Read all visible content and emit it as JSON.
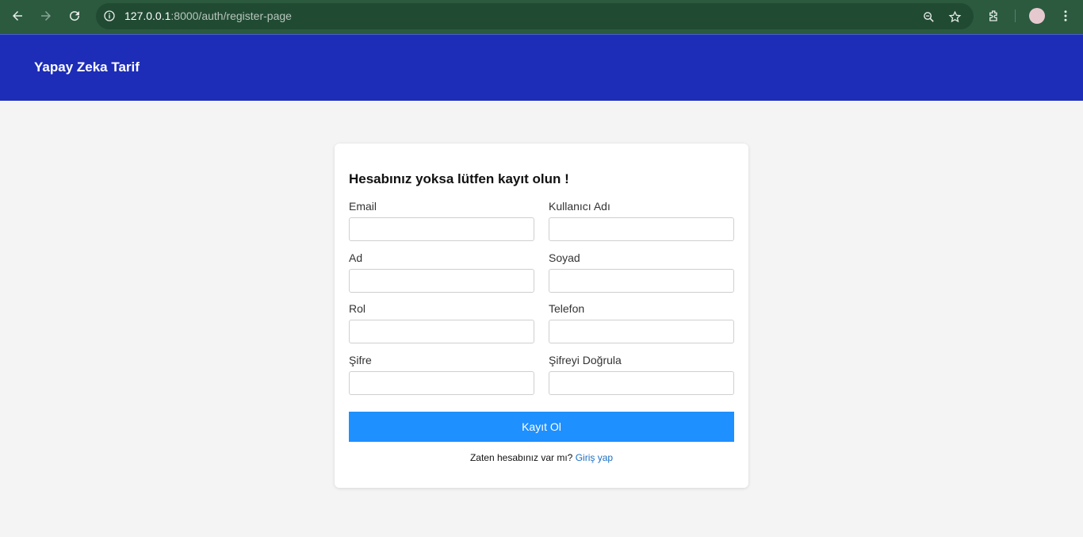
{
  "browser": {
    "url_host": "127.0.0.1",
    "url_rest": ":8000/auth/register-page",
    "icons": [
      "back-icon",
      "forward-icon",
      "reload-icon",
      "site-info-icon",
      "zoom-icon",
      "bookmark-star-icon",
      "extensions-icon",
      "profile-avatar",
      "menu-icon"
    ]
  },
  "header": {
    "brand": "Yapay Zeka Tarif"
  },
  "form": {
    "title": "Hesabınız yoksa lütfen kayıt olun !",
    "fields": {
      "email": {
        "label": "Email",
        "value": ""
      },
      "username": {
        "label": "Kullanıcı Adı",
        "value": ""
      },
      "first_name": {
        "label": "Ad",
        "value": ""
      },
      "last_name": {
        "label": "Soyad",
        "value": ""
      },
      "role": {
        "label": "Rol",
        "value": ""
      },
      "phone": {
        "label": "Telefon",
        "value": ""
      },
      "password": {
        "label": "Şifre",
        "value": ""
      },
      "password_confirm": {
        "label": "Şifreyi Doğrula",
        "value": ""
      }
    },
    "submit_label": "Kayıt Ol",
    "footer_text": "Zaten hesabınız var mı?",
    "login_link": "Giriş yap"
  },
  "colors": {
    "header_bg": "#1d2db8",
    "button_bg": "#1e90ff",
    "link": "#1a6fc4"
  }
}
